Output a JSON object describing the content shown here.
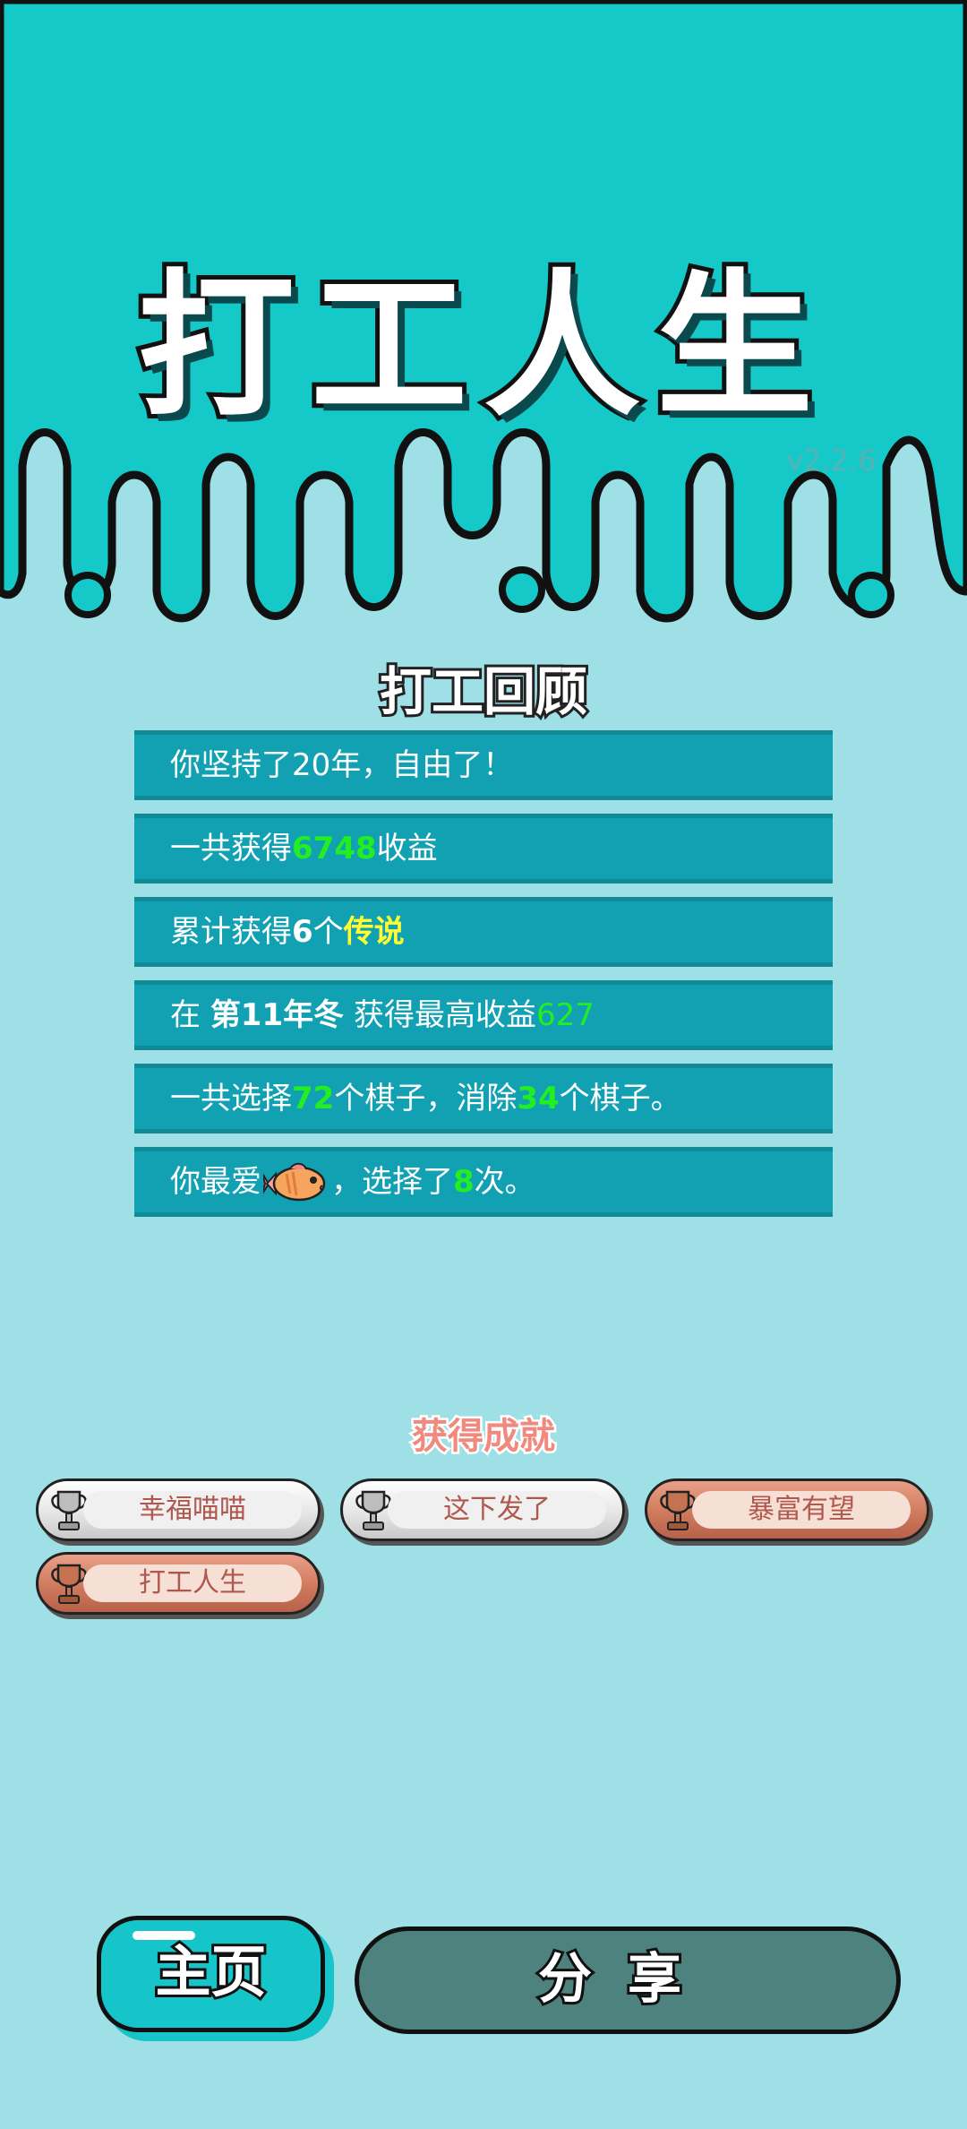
{
  "app_title": "打工人生",
  "version": "v2.2.6",
  "review": {
    "heading": "打工回顾",
    "row1": {
      "text": "你坚持了20年，自由了！"
    },
    "row2": {
      "prefix": "一共获得",
      "value": "6748",
      "suffix": "收益"
    },
    "row3": {
      "prefix": "累计获得",
      "count": "6",
      "mid": "个",
      "grade": "传说"
    },
    "row4": {
      "prefix": "在 ",
      "season": "第11年冬",
      "mid": " 获得最高收益",
      "value": "627"
    },
    "row5": {
      "p1": "一共选择",
      "chosen": "72",
      "p2": "个棋子，消除",
      "removed": "34",
      "p3": "个棋子。"
    },
    "row6": {
      "prefix": "你最爱",
      "icon": "fish-icon",
      "mid": "，选择了",
      "times": "8",
      "suffix": "次。"
    }
  },
  "achievements": {
    "heading": "获得成就",
    "items": [
      {
        "label": "幸福喵喵",
        "tier": "silver"
      },
      {
        "label": "这下发了",
        "tier": "silver"
      },
      {
        "label": "暴富有望",
        "tier": "bronze"
      },
      {
        "label": "打工人生",
        "tier": "bronze"
      }
    ]
  },
  "buttons": {
    "home": "主页",
    "share": "分享"
  },
  "colors": {
    "header_bg": "#16c9c9",
    "body_bg": "#9fdfe6",
    "row_bg": "#12a1b2",
    "highlight_green": "#22ee22",
    "highlight_yellow": "#ffff33",
    "share_bg": "#4e827e"
  }
}
